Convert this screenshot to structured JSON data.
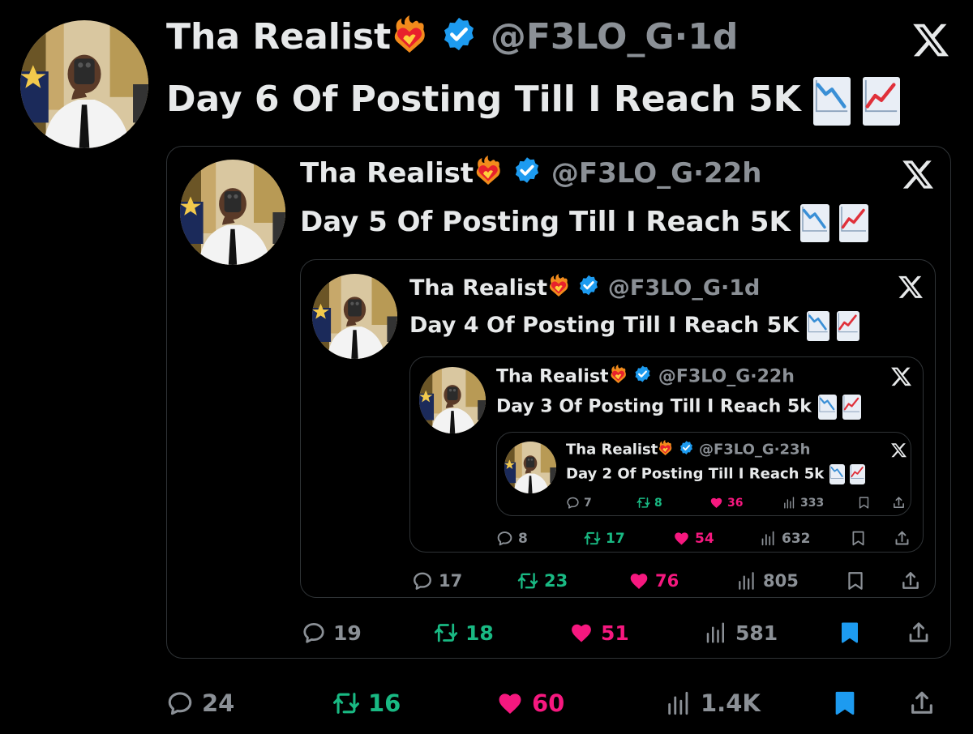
{
  "tweets": [
    {
      "name": "Tha Realist",
      "handle": "@F3LO_G",
      "time": "1d",
      "text": "Day 6 Of Posting Till I Reach 5K",
      "replies": "24",
      "retweets": "16",
      "likes": "60",
      "views": "1.4K",
      "bookmarked": true
    },
    {
      "name": "Tha Realist",
      "handle": "@F3LO_G",
      "time": "22h",
      "text": "Day 5 Of Posting Till I Reach 5K",
      "replies": "19",
      "retweets": "18",
      "likes": "51",
      "views": "581",
      "bookmarked": true
    },
    {
      "name": "Tha Realist",
      "handle": "@F3LO_G",
      "time": "1d",
      "text": "Day 4 Of Posting Till I Reach 5K",
      "replies": "17",
      "retweets": "23",
      "likes": "76",
      "views": "805",
      "bookmarked": false
    },
    {
      "name": "Tha Realist",
      "handle": "@F3LO_G",
      "time": "22h",
      "text": "Day 3 Of Posting Till I Reach 5k",
      "replies": "8",
      "retweets": "17",
      "likes": "54",
      "views": "632",
      "bookmarked": false
    },
    {
      "name": "Tha Realist",
      "handle": "@F3LO_G",
      "time": "23h",
      "text": "Day 2 Of Posting Till I Reach 5k",
      "replies": "7",
      "retweets": "8",
      "likes": "36",
      "views": "333",
      "bookmarked": false
    }
  ],
  "separator": "·",
  "icons": {
    "heart_emoji": "heart-on-fire-icon",
    "verified": "verified-badge-icon",
    "brand": "x-logo-icon",
    "chart_down": "chart-decreasing-icon",
    "chart_up": "chart-increasing-icon",
    "reply": "reply-icon",
    "retweet": "retweet-icon",
    "like": "like-icon",
    "views": "views-icon",
    "bookmark": "bookmark-icon",
    "share": "share-icon"
  },
  "colors": {
    "background": "#000000",
    "text": "#e7e9ea",
    "muted": "#8b9096",
    "retweet": "#19b983",
    "like": "#f6187f",
    "verified": "#1d9bf0",
    "border": "#2f3336"
  }
}
